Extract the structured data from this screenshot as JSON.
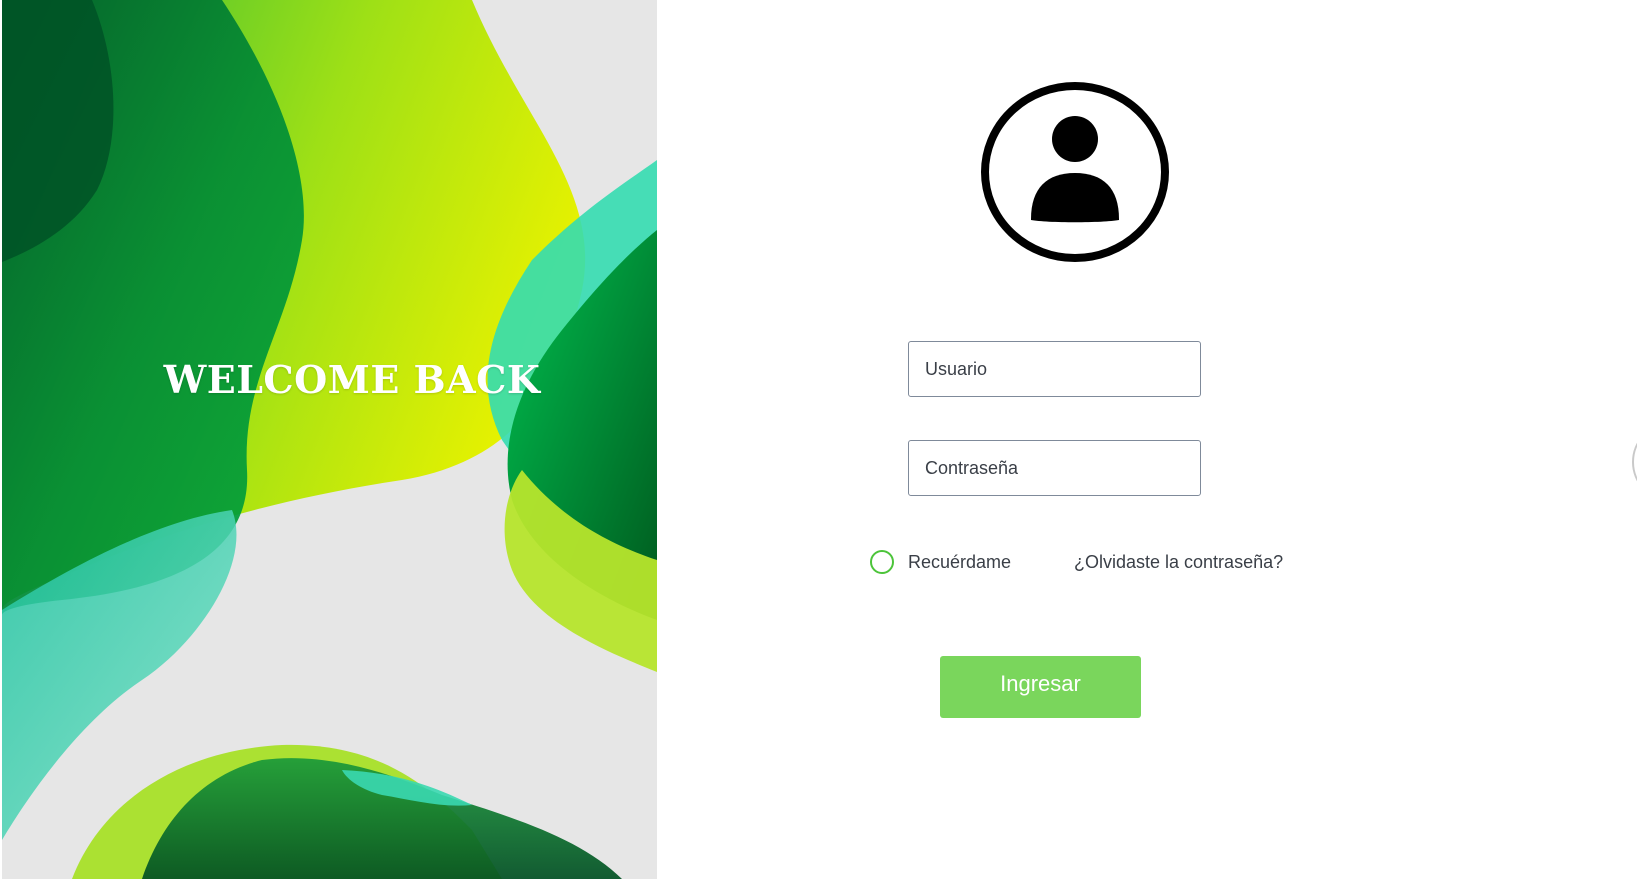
{
  "hero": {
    "title": "WELCOME BACK"
  },
  "login": {
    "username_placeholder": "Usuario",
    "password_placeholder": "Contraseña",
    "remember_label": "Recuérdame",
    "forgot_link": "¿Olvidaste la contraseña?",
    "submit_label": "Ingresar"
  },
  "icons": {
    "avatar": "user-circle-icon"
  },
  "colors": {
    "accent_green": "#7ad65c",
    "radio_border": "#4cc43a",
    "hero_background": "#e6e6e6"
  }
}
